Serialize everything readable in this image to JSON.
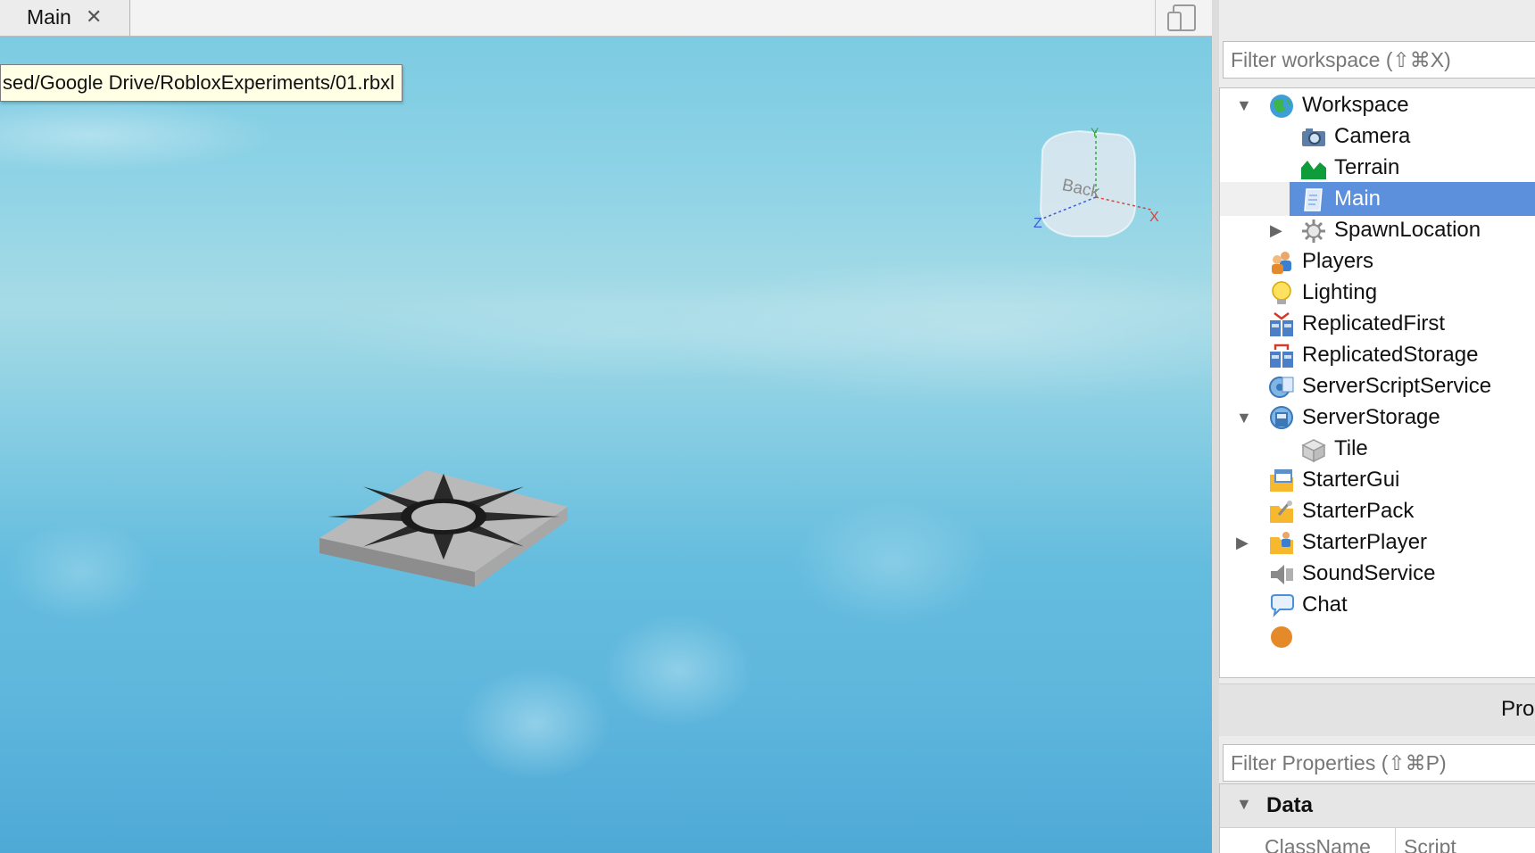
{
  "document_tab": {
    "label": "Main",
    "close_glyph": "✕",
    "tooltip": "sed/Google Drive/RobloxExperiments/01.rbxl"
  },
  "toolbar": {
    "device_icon": "device-emulator-icon"
  },
  "view_cube": {
    "face_label": "Back",
    "axis_x": "X",
    "axis_y": "Y",
    "axis_z": "Z"
  },
  "explorer": {
    "filter_placeholder": "Filter workspace (⇧⌘X)",
    "items": [
      {
        "label": "Workspace",
        "icon": "workspace-globe-icon",
        "expanded": true
      },
      {
        "label": "Camera",
        "icon": "camera-icon"
      },
      {
        "label": "Terrain",
        "icon": "terrain-icon"
      },
      {
        "label": "Main",
        "icon": "script-icon",
        "selected": true
      },
      {
        "label": "SpawnLocation",
        "icon": "spawn-location-icon",
        "collapsed": true
      },
      {
        "label": "Players",
        "icon": "players-icon"
      },
      {
        "label": "Lighting",
        "icon": "lightbulb-icon"
      },
      {
        "label": "ReplicatedFirst",
        "icon": "replicated-first-icon"
      },
      {
        "label": "ReplicatedStorage",
        "icon": "replicated-storage-icon"
      },
      {
        "label": "ServerScriptService",
        "icon": "server-script-service-icon"
      },
      {
        "label": "ServerStorage",
        "icon": "server-storage-icon",
        "expanded": true
      },
      {
        "label": "Tile",
        "icon": "part-icon"
      },
      {
        "label": "StarterGui",
        "icon": "starter-gui-icon"
      },
      {
        "label": "StarterPack",
        "icon": "starter-pack-icon"
      },
      {
        "label": "StarterPlayer",
        "icon": "starter-player-icon",
        "collapsed": true
      },
      {
        "label": "SoundService",
        "icon": "speaker-icon"
      },
      {
        "label": "Chat",
        "icon": "chat-bubble-icon"
      }
    ]
  },
  "properties": {
    "title": "Pro",
    "filter_placeholder": "Filter Properties (⇧⌘P)",
    "category": "Data",
    "rows": [
      {
        "name": "ClassName",
        "value": "Script"
      }
    ]
  },
  "colors": {
    "selection": "#5c8fdc",
    "sky_top": "#7ccbe2",
    "sky_bottom": "#4fa9d6"
  }
}
